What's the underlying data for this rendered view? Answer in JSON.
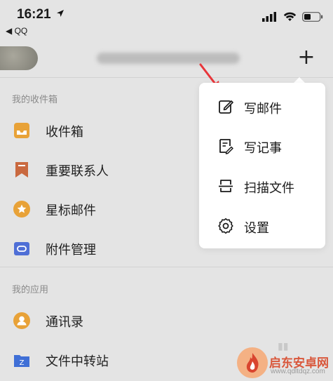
{
  "status_bar": {
    "time": "16:21",
    "back_app": "◀ QQ"
  },
  "header": {
    "add_symbol": "+"
  },
  "sections": {
    "inbox_title": "我的收件箱",
    "apps_title": "我的应用"
  },
  "inbox_items": [
    {
      "label": "收件箱",
      "icon": "inbox-icon"
    },
    {
      "label": "重要联系人",
      "icon": "bookmark-icon"
    },
    {
      "label": "星标邮件",
      "icon": "star-icon"
    },
    {
      "label": "附件管理",
      "icon": "attachment-icon"
    }
  ],
  "app_items": [
    {
      "label": "通讯录",
      "icon": "contacts-icon"
    },
    {
      "label": "文件中转站",
      "icon": "file-transfer-icon"
    }
  ],
  "popup_menu": {
    "items": [
      {
        "label": "写邮件",
        "icon": "compose-icon"
      },
      {
        "label": "写记事",
        "icon": "note-icon"
      },
      {
        "label": "扫描文件",
        "icon": "scan-icon"
      },
      {
        "label": "设置",
        "icon": "gear-icon"
      }
    ]
  },
  "watermark": {
    "name": "启东安卓网",
    "url": "www.qdltdqz.com"
  },
  "colors": {
    "inbox": "#e8a238",
    "contacts_bookmark": "#c9693f",
    "star": "#e8a238",
    "attachment": "#4f6fd6",
    "contacts": "#e8a238",
    "transfer": "#3f6fd6",
    "arrow": "#e8353a"
  }
}
